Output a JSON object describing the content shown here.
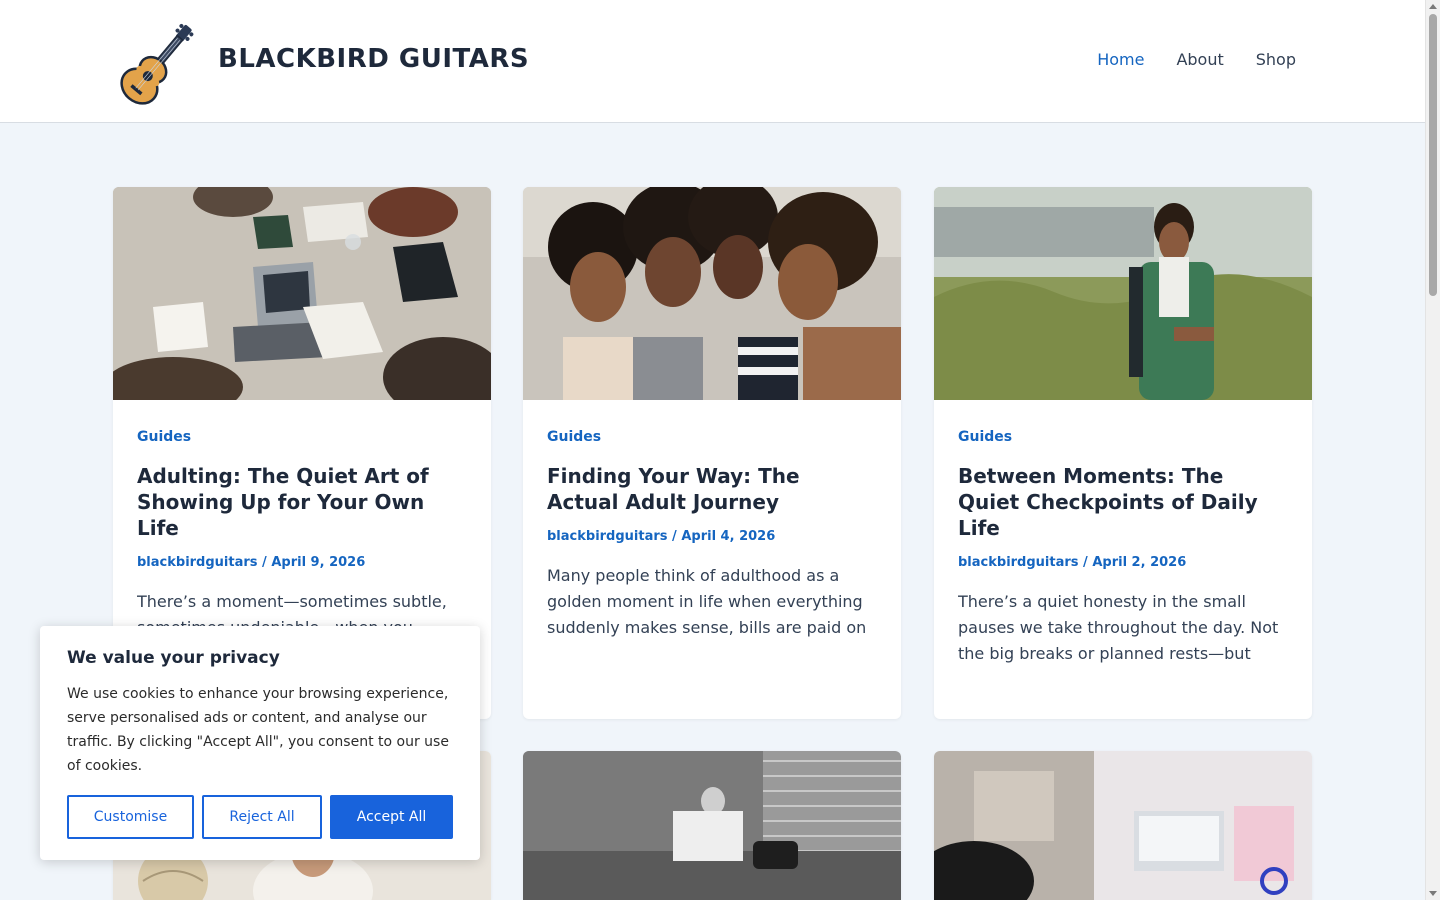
{
  "site": {
    "title": "BLACKBIRD GUITARS",
    "logo_icon": "guitar-icon"
  },
  "nav": {
    "items": [
      {
        "label": "Home",
        "active": true
      },
      {
        "label": "About",
        "active": false
      },
      {
        "label": "Shop",
        "active": false
      }
    ]
  },
  "posts": [
    {
      "category": "Guides",
      "title": "Adulting: The Quiet Art of Showing Up for Your Own Life",
      "author": "blackbirdguitars",
      "date": "April 9, 2026",
      "excerpt": "There’s a moment—sometimes subtle, sometimes undeniable—when you",
      "image": "students-studying-table"
    },
    {
      "category": "Guides",
      "title": "Finding Your Way: The Actual Adult Journey",
      "author": "blackbirdguitars",
      "date": "April 4, 2026",
      "excerpt": "Many people think of adulthood as a golden moment in life when everything suddenly makes sense, bills are paid on",
      "image": "friends-laughing"
    },
    {
      "category": "Guides",
      "title": "Between Moments: The Quiet Checkpoints of Daily Life",
      "author": "blackbirdguitars",
      "date": "April 2, 2026",
      "excerpt": "There’s a quiet honesty in the small pauses we take throughout the day. Not the big breaks or planned rests—but",
      "image": "man-checking-watch"
    },
    {
      "image": "woman-with-globe"
    },
    {
      "image": "man-reading-newspaper"
    },
    {
      "image": "student-desk-laptop"
    }
  ],
  "meta_separator": " / ",
  "cookie": {
    "title": "We value your privacy",
    "text": "We use cookies to enhance your browsing experience, serve personalised ads or content, and analyse our traffic. By clicking \"Accept All\", you consent to our use of cookies.",
    "customise": "Customise",
    "reject": "Reject All",
    "accept": "Accept All"
  },
  "colors": {
    "accent": "#1565c0",
    "cookie_button": "#1863dc",
    "background": "#f0f5fa"
  }
}
